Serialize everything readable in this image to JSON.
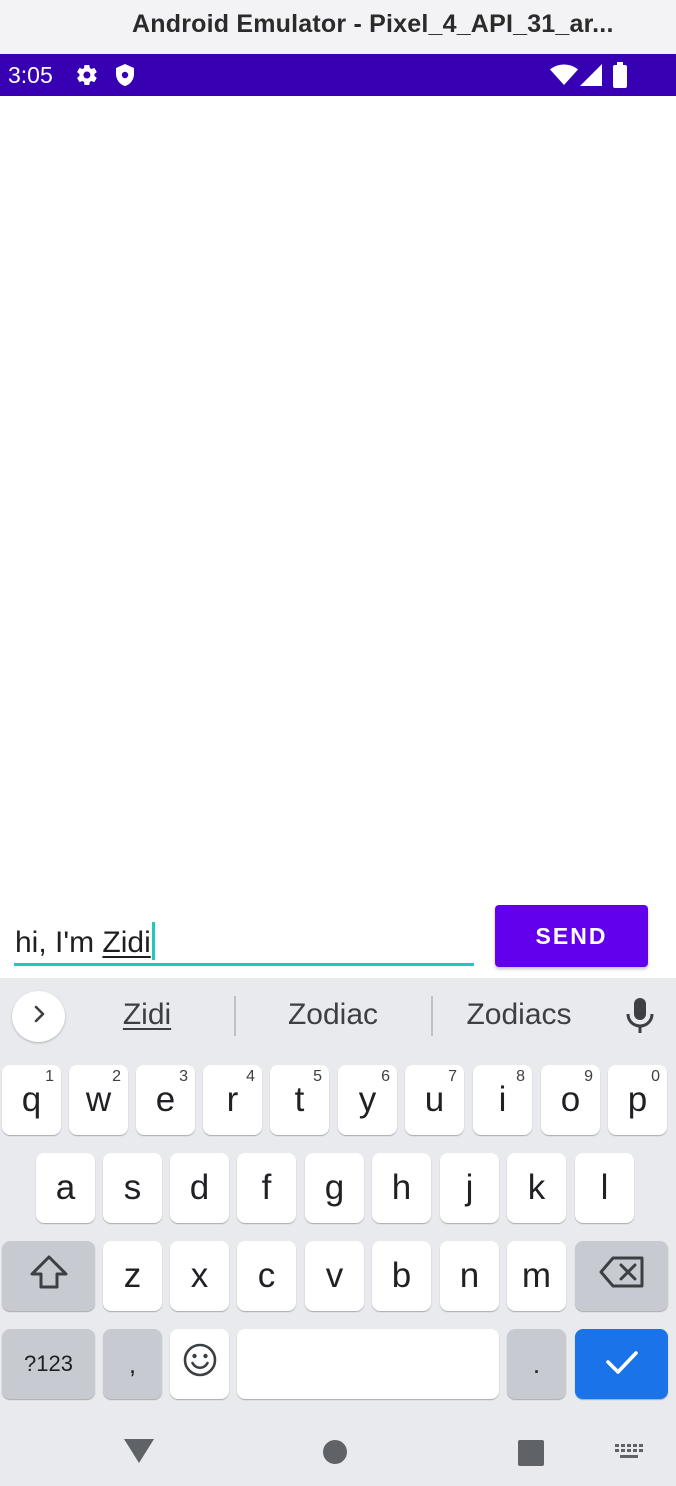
{
  "window": {
    "title": "Android Emulator - Pixel_4_API_31_ar..."
  },
  "status_bar": {
    "time": "3:05",
    "left_icons": [
      "gear-icon",
      "shield-icon"
    ],
    "right_icons": [
      "wifi-icon",
      "signal-icon",
      "battery-icon"
    ],
    "color": "#3700b3"
  },
  "compose": {
    "text_prefix": "hi, I'm ",
    "composing_word": "Zidi",
    "send_label": "SEND",
    "accent_color": "#1fc8c0",
    "button_color": "#6200ee"
  },
  "keyboard": {
    "suggestions": [
      "Zidi",
      "Zodiac",
      "Zodiacs"
    ],
    "row1": [
      {
        "label": "q",
        "hint": "1"
      },
      {
        "label": "w",
        "hint": "2"
      },
      {
        "label": "e",
        "hint": "3"
      },
      {
        "label": "r",
        "hint": "4"
      },
      {
        "label": "t",
        "hint": "5"
      },
      {
        "label": "y",
        "hint": "6"
      },
      {
        "label": "u",
        "hint": "7"
      },
      {
        "label": "i",
        "hint": "8"
      },
      {
        "label": "o",
        "hint": "9"
      },
      {
        "label": "p",
        "hint": "0"
      }
    ],
    "row2": [
      "a",
      "s",
      "d",
      "f",
      "g",
      "h",
      "j",
      "k",
      "l"
    ],
    "row3": [
      "z",
      "x",
      "c",
      "v",
      "b",
      "n",
      "m"
    ],
    "symbols_label": "?123",
    "comma_label": ",",
    "period_label": ".",
    "enter_color": "#1a73e8"
  },
  "nav_bar": {
    "icons": [
      "back-icon",
      "home-icon",
      "recents-icon",
      "keyboard-switch-icon"
    ]
  }
}
